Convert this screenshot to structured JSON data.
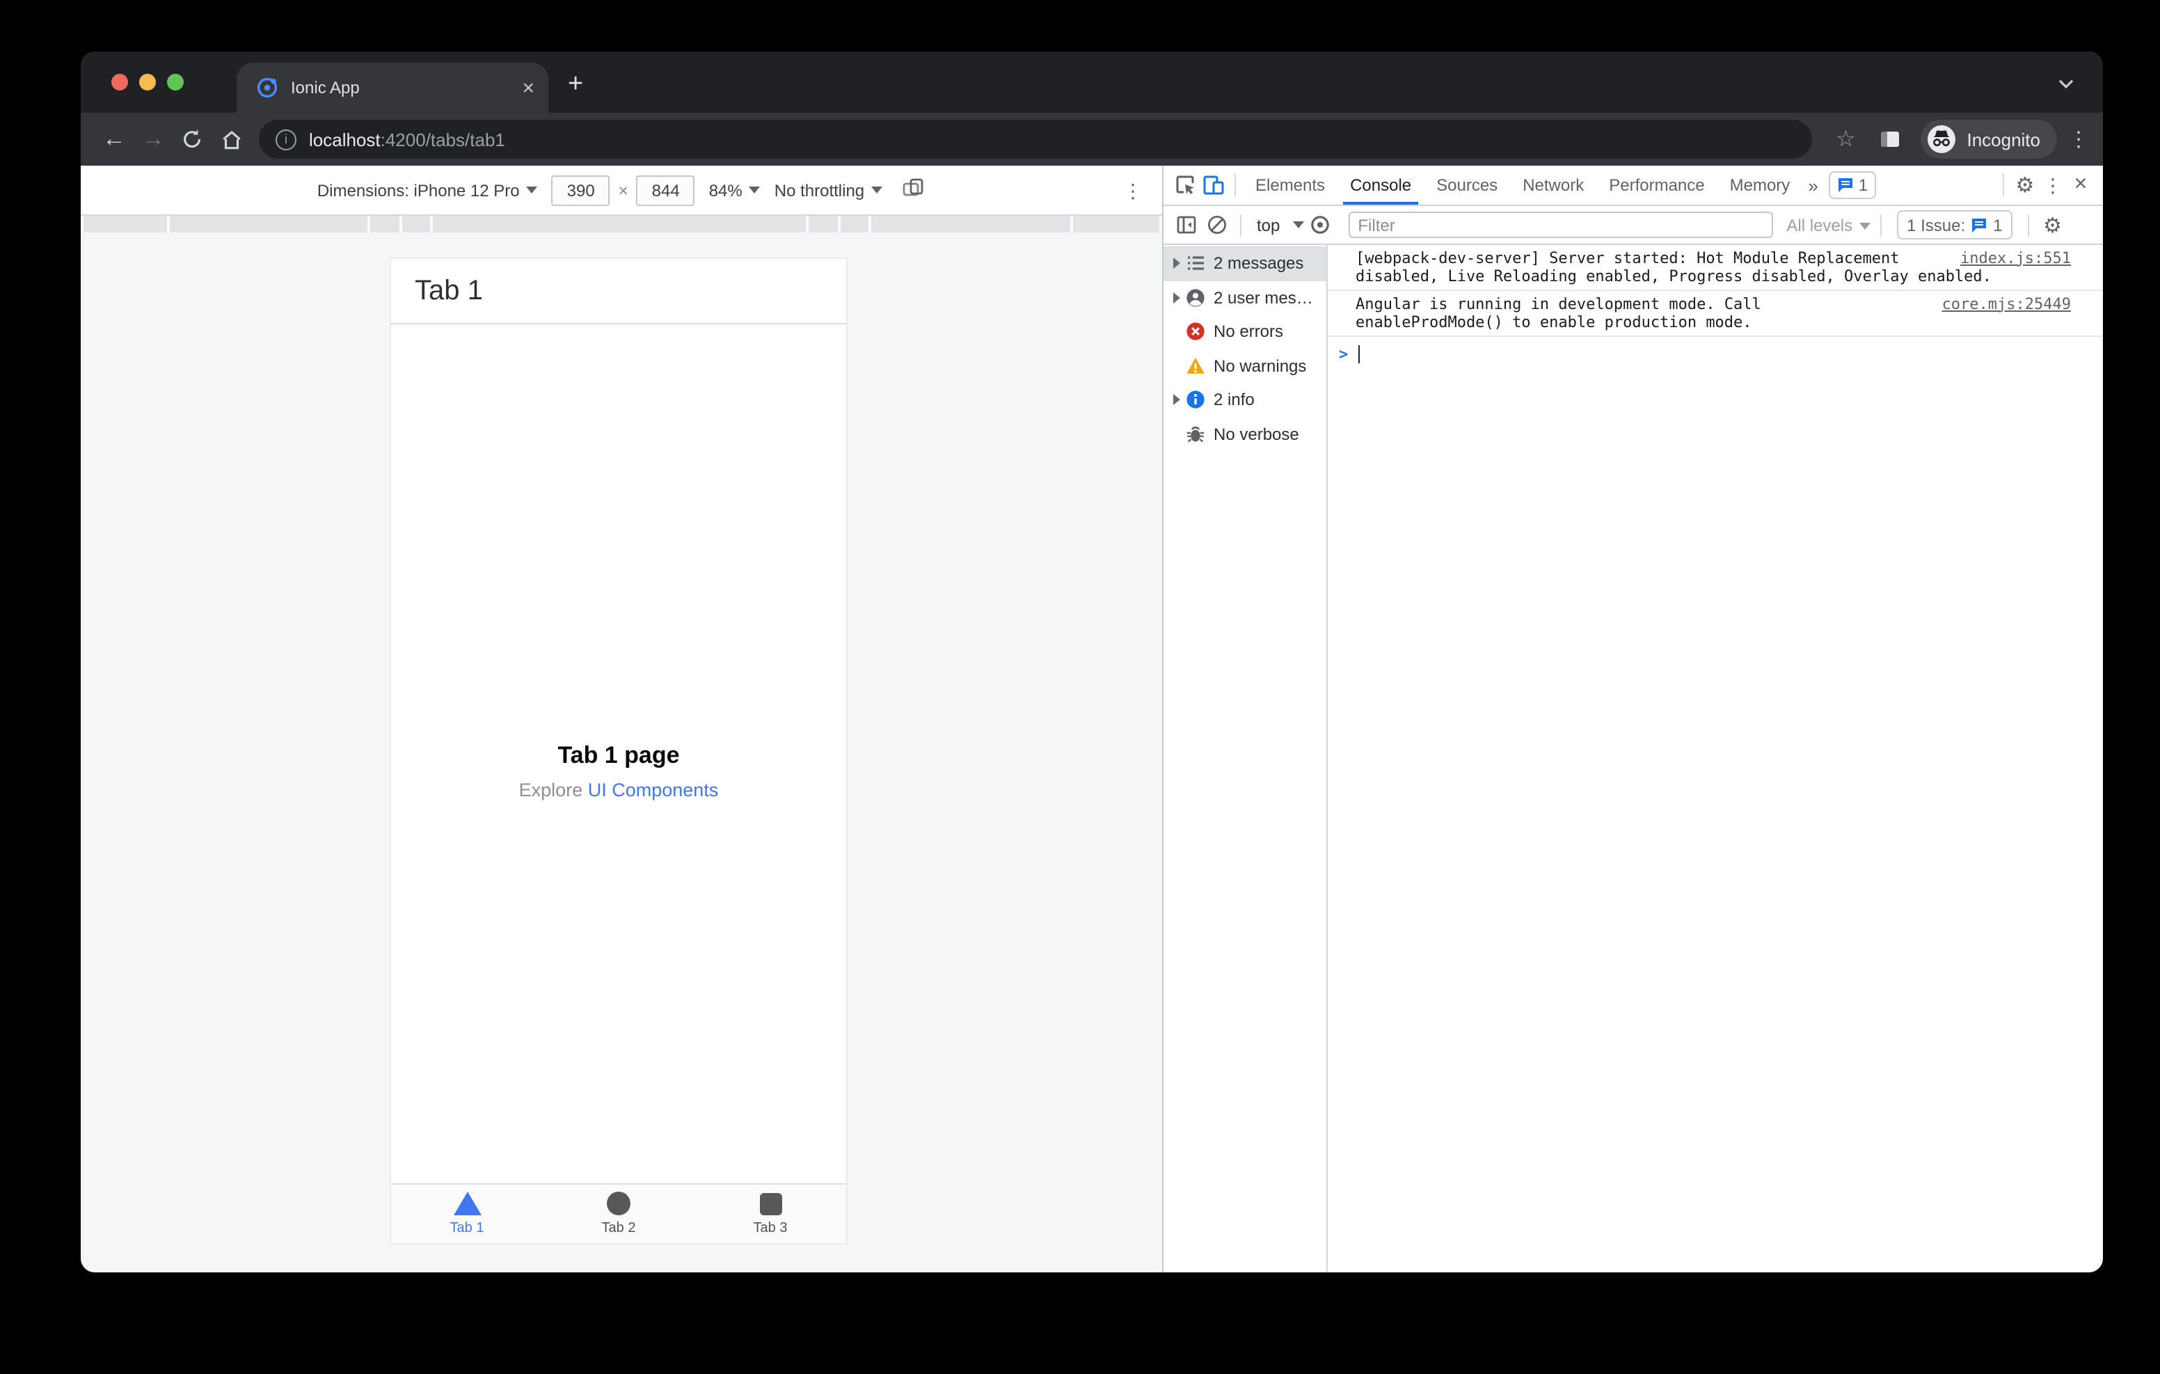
{
  "colors": {
    "accent_blue": "#1a73e8",
    "ionic_blue": "#3f77f0",
    "error_red": "#d93025",
    "warning_yellow": "#f2a60d",
    "dark_titlebar": "#202124",
    "dark_toolbar": "#35363a"
  },
  "browser": {
    "tab_title": "Ionic App",
    "url_host": "localhost",
    "url_rest": ":4200/tabs/tab1",
    "incognito_label": "Incognito"
  },
  "device_toolbar": {
    "dimensions_label": "Dimensions: iPhone 12 Pro",
    "width_value": "390",
    "times": "×",
    "height_value": "844",
    "zoom_value": "84%",
    "throttling_value": "No throttling"
  },
  "app": {
    "header_title": "Tab 1",
    "page_title": "Tab 1 page",
    "subtitle_prefix": "Explore ",
    "subtitle_link": "UI Components",
    "tabs": [
      {
        "label": "Tab 1",
        "icon": "triangle-icon",
        "active": true
      },
      {
        "label": "Tab 2",
        "icon": "circle-icon",
        "active": false
      },
      {
        "label": "Tab 3",
        "icon": "square-icon",
        "active": false
      }
    ]
  },
  "devtools": {
    "tabs": [
      "Elements",
      "Console",
      "Sources",
      "Network",
      "Performance",
      "Memory"
    ],
    "active_tab": "Console",
    "more_tabs_glyph": "»",
    "flag_badge_count": "1",
    "console_toolbar": {
      "context": "top",
      "filter_placeholder": "Filter",
      "levels_label": "All levels",
      "issues_label": "1 Issue:",
      "issues_count": "1"
    },
    "sidebar": [
      {
        "label": "2 messages",
        "icon": "list-icon",
        "selected": true
      },
      {
        "label": "2 user mes…",
        "icon": "user-icon",
        "selected": false
      },
      {
        "label": "No errors",
        "icon": "error-icon",
        "selected": false
      },
      {
        "label": "No warnings",
        "icon": "warning-icon",
        "selected": false
      },
      {
        "label": "2 info",
        "icon": "info-icon",
        "selected": false
      },
      {
        "label": "No verbose",
        "icon": "bug-icon",
        "selected": false
      }
    ],
    "messages": [
      {
        "text": "[webpack-dev-server] Server started: Hot Module Replacement disabled, Live Reloading enabled, Progress disabled, Overlay enabled.",
        "source": "index.js:551"
      },
      {
        "text": "Angular is running in development mode. Call enableProdMode() to enable production mode.",
        "source": "core.mjs:25449"
      }
    ],
    "prompt_glyph": ">"
  }
}
